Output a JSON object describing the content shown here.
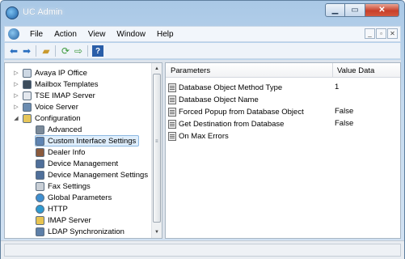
{
  "window": {
    "title": "UC Admin"
  },
  "menu": {
    "items": [
      "File",
      "Action",
      "View",
      "Window",
      "Help"
    ]
  },
  "toolbar": {
    "icons": [
      "back-icon",
      "forward-icon",
      "folder-up-icon",
      "refresh-icon",
      "export-icon",
      "help-icon"
    ]
  },
  "tree": {
    "items": [
      {
        "label": "Avaya IP Office",
        "expander": "▷"
      },
      {
        "label": "Mailbox Templates",
        "expander": "▷"
      },
      {
        "label": "TSE IMAP Server",
        "expander": "▷"
      },
      {
        "label": "Voice Server",
        "expander": "▷"
      },
      {
        "label": "Configuration",
        "expander": "◢"
      },
      {
        "label": "Advanced",
        "expander": ""
      },
      {
        "label": "Custom Interface Settings",
        "expander": ""
      },
      {
        "label": "Dealer Info",
        "expander": ""
      },
      {
        "label": "Device Management",
        "expander": ""
      },
      {
        "label": "Device Management Settings",
        "expander": ""
      },
      {
        "label": "Fax Settings",
        "expander": ""
      },
      {
        "label": "Global Parameters",
        "expander": ""
      },
      {
        "label": "HTTP",
        "expander": ""
      },
      {
        "label": "IMAP Server",
        "expander": ""
      },
      {
        "label": "LDAP Synchronization",
        "expander": ""
      }
    ],
    "selected": "Custom Interface Settings"
  },
  "list": {
    "columns": [
      "Parameters",
      "Value Data"
    ],
    "rows": [
      {
        "param": "Database Object Method Type",
        "value": "1"
      },
      {
        "param": "Database Object Name",
        "value": ""
      },
      {
        "param": "Forced Popup from Database Object",
        "value": "False"
      },
      {
        "param": "Get Destination from Database",
        "value": "False"
      },
      {
        "param": "On Max Errors",
        "value": ""
      }
    ]
  },
  "colors": {
    "titlebar": "#a9c8e6",
    "selection": "#dfeefc",
    "close_button": "#c8402a"
  }
}
